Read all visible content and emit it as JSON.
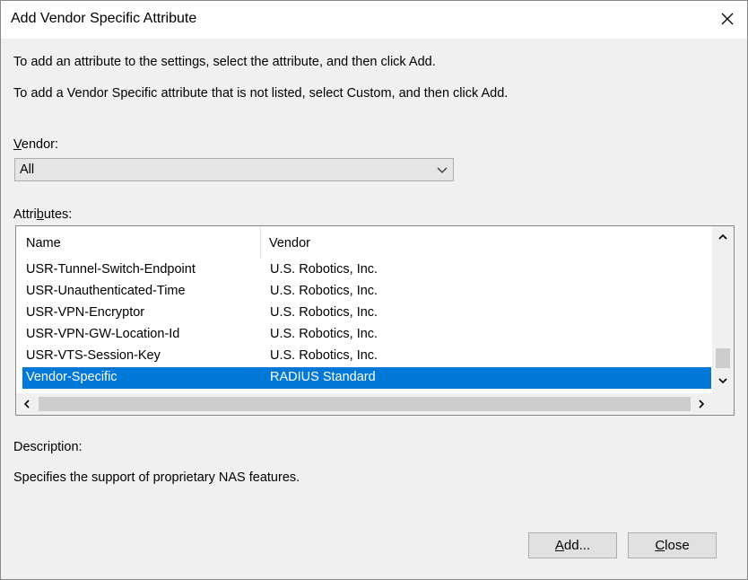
{
  "window": {
    "title": "Add Vendor Specific Attribute"
  },
  "instructions": {
    "line1": "To add an attribute to the settings, select the attribute, and then click Add.",
    "line2": "To add a Vendor Specific attribute that is not listed, select Custom, and then click Add."
  },
  "vendor": {
    "label_prefix": "",
    "label_accel": "V",
    "label_rest": "endor:",
    "selected": "All"
  },
  "attributes": {
    "label_prefix": "Attri",
    "label_accel": "b",
    "label_rest": "utes:",
    "columns": [
      "Name",
      "Vendor"
    ],
    "rows": [
      {
        "name": "USR-Tunnel-Switch-Endpoint",
        "vendor": "U.S. Robotics, Inc."
      },
      {
        "name": "USR-Unauthenticated-Time",
        "vendor": "U.S. Robotics, Inc."
      },
      {
        "name": "USR-VPN-Encryptor",
        "vendor": "U.S. Robotics, Inc."
      },
      {
        "name": "USR-VPN-GW-Location-Id",
        "vendor": "U.S. Robotics, Inc."
      },
      {
        "name": "USR-VTS-Session-Key",
        "vendor": "U.S. Robotics, Inc."
      },
      {
        "name": "Vendor-Specific",
        "vendor": "RADIUS Standard",
        "selected": true
      }
    ]
  },
  "description": {
    "label": "Description:",
    "text": "Specifies the support of proprietary NAS features."
  },
  "buttons": {
    "add_accel": "A",
    "add_rest": "dd...",
    "close_accel": "C",
    "close_rest": "lose"
  },
  "colors": {
    "selection": "#0078d7",
    "background": "#f0f0f0"
  }
}
